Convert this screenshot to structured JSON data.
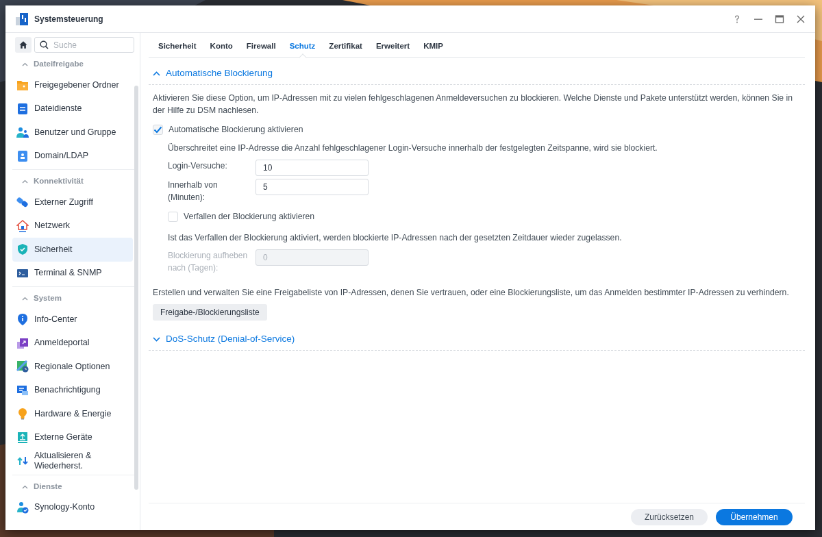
{
  "window": {
    "title": "Systemsteuerung"
  },
  "sidebar": {
    "search": {
      "placeholder": "Suche"
    },
    "groups": [
      {
        "label": "Dateifreigabe",
        "expanded": true,
        "items": [
          {
            "label": "Freigegebener Ordner",
            "selected": false
          },
          {
            "label": "Dateidienste",
            "selected": false
          },
          {
            "label": "Benutzer und Gruppe",
            "selected": false
          },
          {
            "label": "Domain/LDAP",
            "selected": false
          }
        ]
      },
      {
        "label": "Konnektivität",
        "expanded": true,
        "items": [
          {
            "label": "Externer Zugriff",
            "selected": false
          },
          {
            "label": "Netzwerk",
            "selected": false
          },
          {
            "label": "Sicherheit",
            "selected": true
          },
          {
            "label": "Terminal & SNMP",
            "selected": false
          }
        ]
      },
      {
        "label": "System",
        "expanded": true,
        "items": [
          {
            "label": "Info-Center",
            "selected": false
          },
          {
            "label": "Anmeldeportal",
            "selected": false
          },
          {
            "label": "Regionale Optionen",
            "selected": false
          },
          {
            "label": "Benachrichtigung",
            "selected": false
          },
          {
            "label": "Hardware & Energie",
            "selected": false
          },
          {
            "label": "Externe Geräte",
            "selected": false
          },
          {
            "label": "Aktualisieren & Wiederherst.",
            "selected": false
          }
        ]
      },
      {
        "label": "Dienste",
        "expanded": true,
        "items": [
          {
            "label": "Synology-Konto",
            "selected": false
          }
        ]
      }
    ]
  },
  "tabs": [
    {
      "label": "Sicherheit",
      "selected": false
    },
    {
      "label": "Konto",
      "selected": false
    },
    {
      "label": "Firewall",
      "selected": false
    },
    {
      "label": "Schutz",
      "selected": true
    },
    {
      "label": "Zertifikat",
      "selected": false
    },
    {
      "label": "Erweitert",
      "selected": false
    },
    {
      "label": "KMIP",
      "selected": false
    }
  ],
  "sections": [
    {
      "title": "Automatische Blockierung",
      "expanded": true,
      "content": [
        {
          "kind": "text",
          "text": "Aktivieren Sie diese Option, um IP-Adressen mit zu vielen fehlgeschlagenen Anmeldeversuchen zu blockieren. Welche Dienste und Pakete unterstützt werden, können Sie in der Hilfe zu DSM nachlesen."
        },
        {
          "kind": "checkbox",
          "label": "Automatische Blockierung aktivieren",
          "checked": true
        },
        {
          "kind": "note",
          "text": "Überschreitet eine IP-Adresse die Anzahl fehlgeschlagener Login-Versuche innerhalb der festgelegten Zeitspanne, wird sie blockiert."
        },
        {
          "kind": "field",
          "label": "Login-Versuche:",
          "value": "10",
          "disabled": false
        },
        {
          "kind": "field",
          "label": "Innerhalb von (Minuten):",
          "value": "5",
          "disabled": false
        },
        {
          "kind": "subcheckbox",
          "label": "Verfallen der Blockierung aktivieren",
          "checked": false
        },
        {
          "kind": "note",
          "text": "Ist das Verfallen der Blockierung aktiviert, werden blockierte IP-Adressen nach der gesetzten Zeitdauer wieder zugelassen."
        },
        {
          "kind": "field",
          "label": "Blockierung aufheben nach (Tagen):",
          "value": "0",
          "disabled": true
        },
        {
          "kind": "text",
          "text": "Erstellen und verwalten Sie eine Freigabeliste von IP-Adressen, denen Sie vertrauen, oder eine Blockierungsliste, um das Anmelden bestimmter IP-Adressen zu verhindern."
        },
        {
          "kind": "button",
          "label": "Freigabe-/Blockierungsliste"
        }
      ]
    },
    {
      "title": "DoS-Schutz (Denial-of-Service)",
      "expanded": false
    }
  ],
  "footer": {
    "buttons": [
      {
        "label": "Zurücksetzen",
        "kind": "secondary"
      },
      {
        "label": "Übernehmen",
        "kind": "primary"
      }
    ]
  }
}
